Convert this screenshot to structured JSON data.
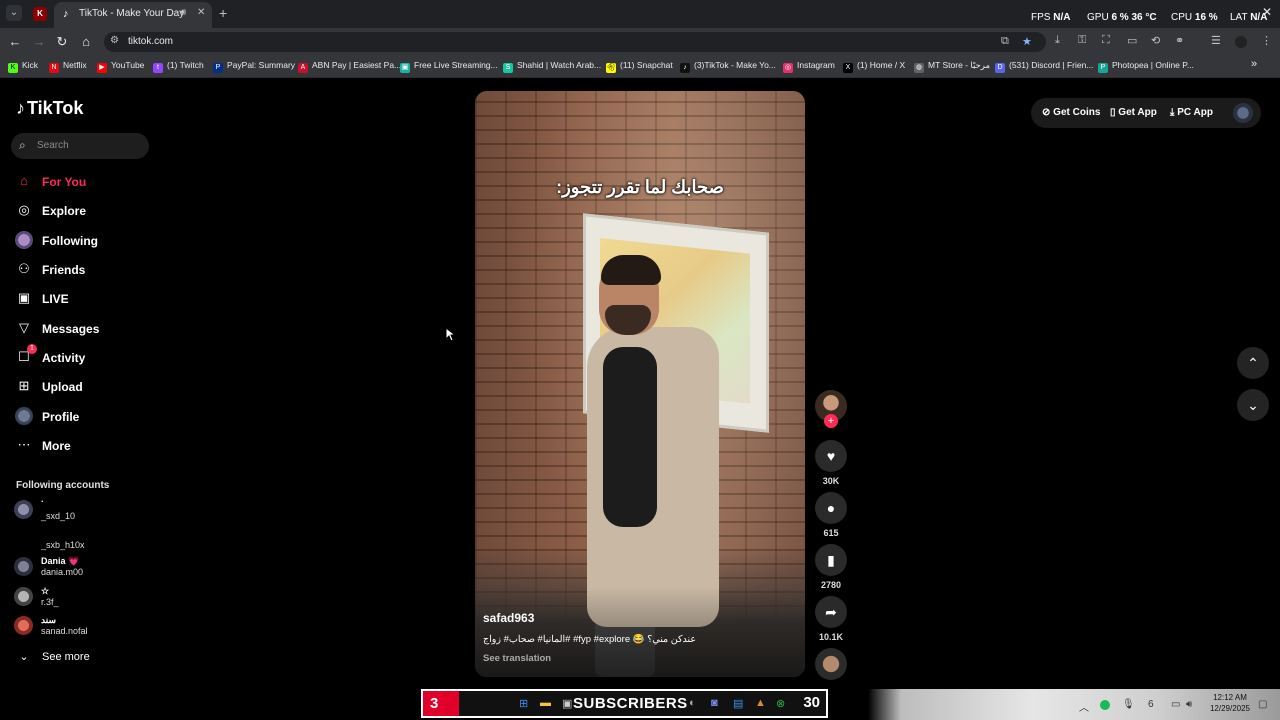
{
  "browser": {
    "active_tab_title": "TikTok - Make Your Day",
    "url": "tiktok.com",
    "bookmarks": [
      {
        "label": "Kick",
        "color": "#53fc18"
      },
      {
        "label": "Netflix",
        "color": "#e50914"
      },
      {
        "label": "YouTube",
        "color": "#ff0000"
      },
      {
        "label": "(1) Twitch",
        "color": "#9146ff"
      },
      {
        "label": "PayPal: Summary",
        "color": "#003087"
      },
      {
        "label": "ABN Pay | Easiest Pa...",
        "color": "#c8102e"
      },
      {
        "label": "Free Live Streaming...",
        "color": "#1bb3a6"
      },
      {
        "label": "Shahid | Watch Arab...",
        "color": "#18c6a0"
      },
      {
        "label": "(11) Snapchat",
        "color": "#fffc00"
      },
      {
        "label": "(3)TikTok - Make Yo...",
        "color": "#111111"
      },
      {
        "label": "Instagram",
        "color": "#e1306c"
      },
      {
        "label": "(1) Home / X",
        "color": "#000000"
      },
      {
        "label": "MT Store - مرحبًا",
        "color": "#5f6368"
      },
      {
        "label": "(531) Discord | Frien...",
        "color": "#5865f2"
      },
      {
        "label": "Photopea | Online P...",
        "color": "#18a497"
      }
    ],
    "sysmon": {
      "fps_label": "FPS",
      "fps_value": "N/A",
      "gpu_label": "GPU",
      "gpu_value": "6 %",
      "gpu_temp": "36 °C",
      "cpu_label": "CPU",
      "cpu_value": "16 %",
      "lat_label": "LAT",
      "lat_value": "N/A"
    }
  },
  "tiktok": {
    "logo": "TikTok",
    "search_placeholder": "Search",
    "nav": [
      {
        "label": "For You",
        "icon": "home-icon",
        "active": true
      },
      {
        "label": "Explore",
        "icon": "compass-icon"
      },
      {
        "label": "Following",
        "icon": "following-avatar-icon"
      },
      {
        "label": "Friends",
        "icon": "friends-icon"
      },
      {
        "label": "LIVE",
        "icon": "live-icon"
      },
      {
        "label": "Messages",
        "icon": "messages-icon"
      },
      {
        "label": "Activity",
        "icon": "activity-icon",
        "badge": "1"
      },
      {
        "label": "Upload",
        "icon": "upload-icon"
      },
      {
        "label": "Profile",
        "icon": "profile-icon"
      },
      {
        "label": "More",
        "icon": "more-icon"
      }
    ],
    "following_title": "Following accounts",
    "accounts": [
      {
        "name": ".",
        "username": "_sxd_10"
      },
      {
        "name": "",
        "username": "_sxb_h10x"
      },
      {
        "name": "Dania 💗",
        "username": "dania.m00"
      },
      {
        "name": "☆",
        "username": "r.3f_"
      },
      {
        "name": "سند",
        "username": "sanad.nofal"
      }
    ],
    "see_more": "See more",
    "top_right": {
      "get_coins": "Get Coins",
      "get_app": "Get App",
      "pc_app": "PC App"
    },
    "video": {
      "overlay_caption": "صحابك لما تقرر تتجوز:",
      "author": "safad963",
      "description": "المانيا# صحاب# زواج# #fyp #explore 😂 عندكن مني؟",
      "see_translation": "See translation",
      "likes": "30K",
      "comments": "615",
      "saves": "2780",
      "shares": "10.1K"
    }
  },
  "taskbar": {
    "left_number": "3",
    "subscribers_label": "SUBSCRIBERS",
    "right_number": "30",
    "time": "12:12 AM",
    "date": "12/29/2025"
  }
}
